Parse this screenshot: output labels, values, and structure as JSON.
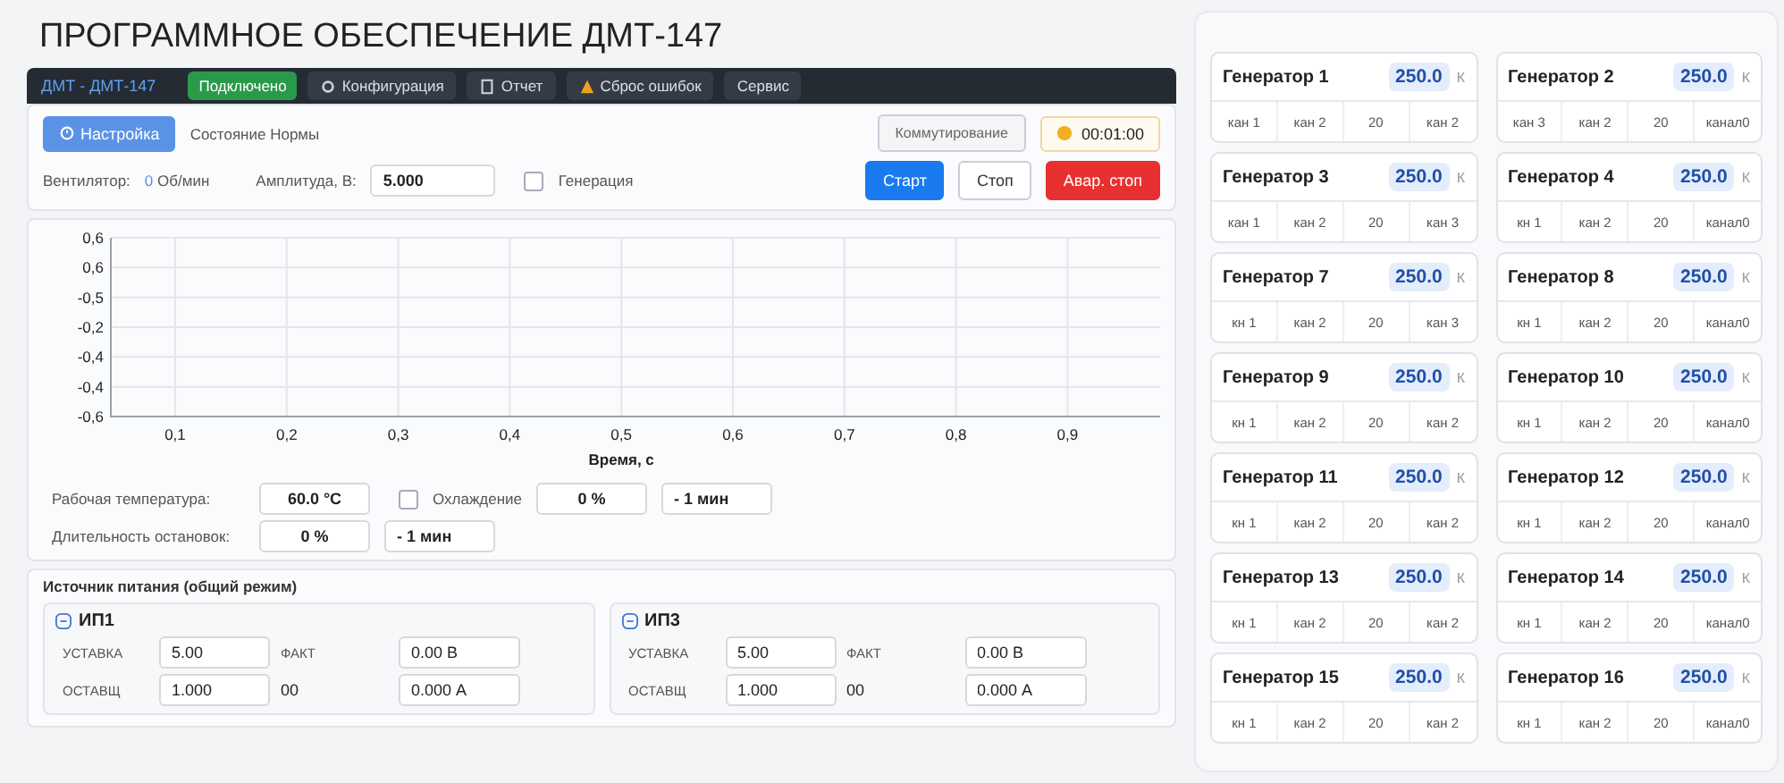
{
  "title": "ПРОГРАММНОЕ ОБЕСПЕЧЕНИЕ ДМТ-147",
  "navbar": {
    "brand": "ДМТ - ДМТ-147",
    "items": [
      {
        "label": "Подключено",
        "kind": "status"
      },
      {
        "label": "Конфигурация",
        "kind": "menu"
      },
      {
        "label": "Отчет",
        "kind": "menu"
      },
      {
        "label": "Сброс ошибок",
        "kind": "menu"
      },
      {
        "label": "Сервис",
        "kind": "menu"
      }
    ]
  },
  "controls": {
    "settings": {
      "label": "Настройка",
      "selected": true
    },
    "state": "Состояние Нормы",
    "switching": "Коммутирование",
    "timer": "00:01:00",
    "fan_label": "Вентилятор:",
    "fan_value": "0",
    "fan_unit": "Об/мин",
    "amplitude_label": "Амплитуда, В:",
    "amplitude": "5.000",
    "generation": {
      "label": "Генерация",
      "checked": false
    },
    "buttons": [
      {
        "label": "Старт",
        "kind": "primary"
      },
      {
        "label": "Стоп",
        "kind": "default"
      },
      {
        "label": "Авар. стоп",
        "kind": "danger"
      }
    ]
  },
  "chart": {
    "y_axis_labels": [
      "0,6",
      "0,6",
      "-0,5",
      "-0,2",
      "-0,4",
      "-0,4",
      "-0,6"
    ],
    "x_axis_labels": [
      "0,1",
      "0,2",
      "0,3",
      "0,4",
      "0,5",
      "0,6",
      "0,7",
      "0,8",
      "0,9"
    ],
    "x_axis_title": "Время, с"
  },
  "temperature": {
    "label": "Рабочая температура:",
    "value": "60.0 °C",
    "cooling": {
      "label": "Охлаждение",
      "checked": false
    },
    "cooling_percent": "0 %",
    "cooling_time": "- 1 мин",
    "duration_label": "Длительность остановок:",
    "duration_percent": "0 %",
    "duration_time": "- 1 мин"
  },
  "power": {
    "title": "Источник питания (общий режим)",
    "units": [
      {
        "name": "ИП1",
        "expanded": true,
        "setpoint_label": "УСТАВКА",
        "setpoint": "5.00",
        "limit_label": "ОСТАВЩ",
        "limit": "1.000",
        "fact_label": "ФАКТ",
        "fact": "0.00 В",
        "mode": "00",
        "current": "0.000 А"
      },
      {
        "name": "ИП3",
        "expanded": true,
        "setpoint_label": "УСТАВКА",
        "setpoint": "5.00",
        "limit_label": "ОСТАВЩ",
        "limit": "1.000",
        "fact_label": "ФАКТ",
        "fact": "0.00 В",
        "mode": "00",
        "current": "0.000 А"
      }
    ]
  },
  "generators": [
    {
      "name": "Генератор 1",
      "value": "250.0",
      "unit": "К",
      "cells": [
        "кан 1",
        "кан 2",
        "20",
        "кан 2"
      ]
    },
    {
      "name": "Генератор 2",
      "value": "250.0",
      "unit": "К",
      "cells": [
        "кан 3",
        "кан 2",
        "20",
        "канал0"
      ]
    },
    {
      "name": "Генератор 3",
      "value": "250.0",
      "unit": "К",
      "cells": [
        "кан 1",
        "кан 2",
        "20",
        "кан 3"
      ]
    },
    {
      "name": "Генератор 4",
      "value": "250.0",
      "unit": "К",
      "cells": [
        "кн 1",
        "кан 2",
        "20",
        "канал0"
      ]
    },
    {
      "name": "Генератор 7",
      "value": "250.0",
      "unit": "К",
      "cells": [
        "кн 1",
        "кан 2",
        "20",
        "кан 3"
      ]
    },
    {
      "name": "Генератор 8",
      "value": "250.0",
      "unit": "К",
      "cells": [
        "кн 1",
        "кан 2",
        "20",
        "канал0"
      ]
    },
    {
      "name": "Генератор 9",
      "value": "250.0",
      "unit": "К",
      "cells": [
        "кн 1",
        "кан 2",
        "20",
        "кан 2"
      ]
    },
    {
      "name": "Генератор 10",
      "value": "250.0",
      "unit": "К",
      "cells": [
        "кн 1",
        "кан 2",
        "20",
        "канал0"
      ]
    },
    {
      "name": "Генератор 11",
      "value": "250.0",
      "unit": "К",
      "cells": [
        "кн 1",
        "кан 2",
        "20",
        "кан 2"
      ]
    },
    {
      "name": "Генератор 12",
      "value": "250.0",
      "unit": "К",
      "cells": [
        "кн 1",
        "кан 2",
        "20",
        "канал0"
      ]
    },
    {
      "name": "Генератор 13",
      "value": "250.0",
      "unit": "К",
      "cells": [
        "кн 1",
        "кан 2",
        "20",
        "кан 2"
      ]
    },
    {
      "name": "Генератор 14",
      "value": "250.0",
      "unit": "К",
      "cells": [
        "кн 1",
        "кан 2",
        "20",
        "канал0"
      ]
    },
    {
      "name": "Генератор 15",
      "value": "250.0",
      "unit": "К",
      "cells": [
        "кн 1",
        "кан 2",
        "20",
        "кан 2"
      ]
    },
    {
      "name": "Генератор 16",
      "value": "250.0",
      "unit": "К",
      "cells": [
        "кн 1",
        "кан 2",
        "20",
        "канал0"
      ]
    }
  ]
}
